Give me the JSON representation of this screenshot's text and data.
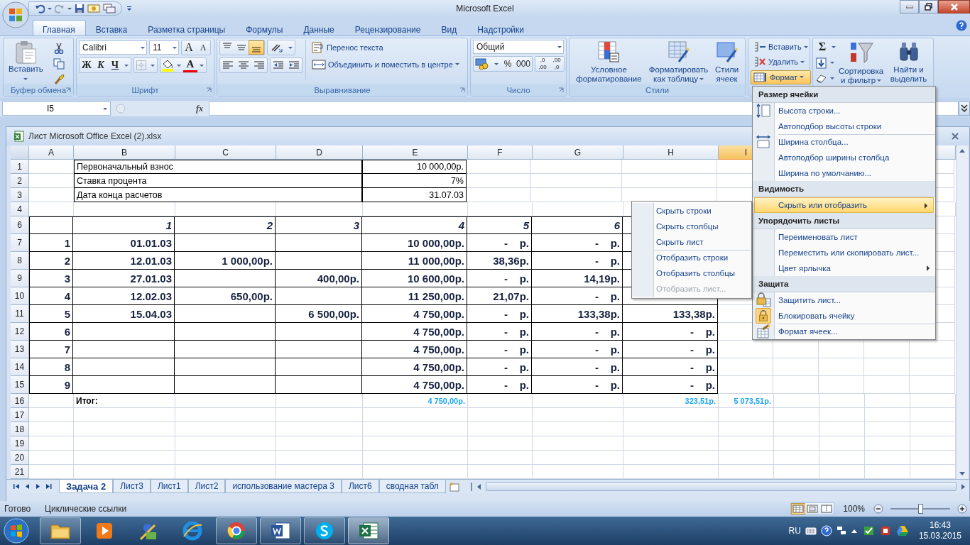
{
  "window": {
    "title": "Microsoft Excel"
  },
  "ribbon_tabs": [
    {
      "label": "Главная",
      "selected": true
    },
    {
      "label": "Вставка",
      "selected": false
    },
    {
      "label": "Разметка страницы",
      "selected": false
    },
    {
      "label": "Формулы",
      "selected": false
    },
    {
      "label": "Данные",
      "selected": false
    },
    {
      "label": "Рецензирование",
      "selected": false
    },
    {
      "label": "Вид",
      "selected": false
    },
    {
      "label": "Надстройки",
      "selected": false
    }
  ],
  "clipboard": {
    "title": "Буфер обмена",
    "paste": "Вставить"
  },
  "font": {
    "title": "Шрифт",
    "font_name": "Calibri",
    "font_size": "11",
    "grow": "A",
    "shrink": "A",
    "bold": "Ж",
    "italic": "К",
    "underline": "Ч",
    "font_color": "A"
  },
  "alignment": {
    "title": "Выравнивание",
    "vertical": [
      {
        "kind": "top",
        "selected": false
      },
      {
        "kind": "middle",
        "selected": false
      },
      {
        "kind": "bottom",
        "selected": true
      }
    ],
    "wrap_text": "Перенос текста",
    "merge": "Объединить и поместить в центре"
  },
  "number": {
    "title": "Число",
    "format": "Общий",
    "percent": "%",
    "thousands": "000",
    "increase_decimal": [
      ",0",
      ",00"
    ],
    "decrease_decimal": [
      ",00",
      ",0"
    ]
  },
  "styles": {
    "title": "Стили",
    "buttons": [
      {
        "label": "Условное\nформатирование",
        "kind": "conditional"
      },
      {
        "label": "Форматировать\nкак таблицу",
        "kind": "table"
      },
      {
        "label": "Стили\nячеек",
        "kind": "cell"
      }
    ]
  },
  "cells": {
    "buttons": [
      {
        "label": "Вставить",
        "kind": "insert",
        "selected": false
      },
      {
        "label": "Удалить",
        "kind": "delete",
        "selected": false
      },
      {
        "label": "Формат",
        "kind": "format",
        "selected": true
      }
    ]
  },
  "editing": {
    "sigma": "Σ",
    "buttons": [
      {
        "label": "Сортировка\nи фильтр",
        "kind": "sort"
      },
      {
        "label": "Найти и\nвыделить",
        "kind": "find"
      }
    ]
  },
  "formula_bar": {
    "name_box": "I5",
    "fx": "fx"
  },
  "workbook": {
    "title": "Лист Microsoft Office Excel (2).xlsx"
  },
  "sheet": {
    "columns": [
      {
        "label": "A",
        "selected": false
      },
      {
        "label": "B",
        "selected": false
      },
      {
        "label": "C",
        "selected": false
      },
      {
        "label": "D",
        "selected": false
      },
      {
        "label": "E",
        "selected": false
      },
      {
        "label": "F",
        "selected": false
      },
      {
        "label": "G",
        "selected": false
      },
      {
        "label": "H",
        "selected": false
      },
      {
        "label": "I",
        "selected": true
      }
    ],
    "rows": [
      {
        "number": "1",
        "kind": "info",
        "cells": {
          "B": "Первоначальный взнос",
          "E": "10 000,00р."
        }
      },
      {
        "number": "2",
        "kind": "info",
        "cells": {
          "B": "Ставка процента",
          "E": "7%"
        }
      },
      {
        "number": "3",
        "kind": "info",
        "cells": {
          "B": "Дата конца расчетов",
          "E": "31.07.03"
        }
      },
      {
        "number": "4",
        "kind": "blank",
        "cells": {}
      },
      {
        "number": "6",
        "kind": "table-head",
        "cells": {
          "B": "1",
          "C": "2",
          "D": "3",
          "E": "4",
          "F": "5",
          "G": "6"
        }
      },
      {
        "number": "7",
        "kind": "table",
        "cells": {
          "A": "1",
          "B": "01.01.03",
          "E": "10 000,00р.",
          "F": "-    р.",
          "G": "-    р."
        }
      },
      {
        "number": "8",
        "kind": "table",
        "cells": {
          "A": "2",
          "B": "12.01.03",
          "C": "1 000,00р.",
          "E": "11 000,00р.",
          "F": "38,36р.",
          "G": "-    р."
        }
      },
      {
        "number": "9",
        "kind": "table",
        "cells": {
          "A": "3",
          "B": "27.01.03",
          "D": "400,00р.",
          "E": "10 600,00р.",
          "F": "-    р.",
          "G": "14,19р."
        }
      },
      {
        "number": "10",
        "kind": "table",
        "cells": {
          "A": "4",
          "B": "12.02.03",
          "C": "650,00р.",
          "E": "11 250,00р.",
          "F": "21,07р.",
          "G": "-    р."
        }
      },
      {
        "number": "11",
        "kind": "table",
        "cells": {
          "A": "5",
          "B": "15.04.03",
          "D": "6 500,00р.",
          "E": "4 750,00р.",
          "F": "-    р.",
          "G": "133,38р.",
          "H": "133,38р."
        }
      },
      {
        "number": "12",
        "kind": "table",
        "cells": {
          "A": "6",
          "E": "4 750,00р.",
          "F": "-    р.",
          "G": "-    р.",
          "H": "-    р."
        }
      },
      {
        "number": "13",
        "kind": "table",
        "cells": {
          "A": "7",
          "E": "4 750,00р.",
          "F": "-    р.",
          "G": "-    р.",
          "H": "-    р."
        }
      },
      {
        "number": "14",
        "kind": "table",
        "cells": {
          "A": "8",
          "E": "4 750,00р.",
          "F": "-    р.",
          "G": "-    р.",
          "H": "-    р."
        }
      },
      {
        "number": "15",
        "kind": "table",
        "cells": {
          "A": "9",
          "E": "4 750,00р.",
          "F": "-    р.",
          "G": "-    р.",
          "H": "-    р."
        }
      },
      {
        "number": "16",
        "kind": "total",
        "cells": {
          "B": "Итог:",
          "E": "4 750,00р.",
          "H": "323,51р.",
          "I": "5 073,51р."
        }
      },
      {
        "number": "17",
        "kind": "blank",
        "cells": {}
      },
      {
        "number": "18",
        "kind": "blank",
        "cells": {}
      },
      {
        "number": "19",
        "kind": "blank",
        "cells": {}
      },
      {
        "number": "20",
        "kind": "blank",
        "cells": {}
      },
      {
        "number": "21",
        "kind": "blank",
        "cells": {}
      }
    ]
  },
  "sheet_tabs": [
    {
      "label": "Задача 2",
      "selected": true
    },
    {
      "label": "Лист3",
      "selected": false
    },
    {
      "label": "Лист1",
      "selected": false
    },
    {
      "label": "Лист2",
      "selected": false
    },
    {
      "label": "использование мастера 3",
      "selected": false
    },
    {
      "label": "Лист6",
      "selected": false
    },
    {
      "label": "сводная табл",
      "selected": false
    }
  ],
  "format_menu": {
    "sections": [
      {
        "title": "Размер ячейки",
        "items": [
          {
            "label": "Высота строки...",
            "kind": "row-height",
            "separator_above": false,
            "highlighted": false,
            "submenu": false,
            "checked": false
          },
          {
            "label": "Автоподбор высоты строки",
            "kind": "plain",
            "separator_above": false,
            "highlighted": false,
            "submenu": false,
            "checked": false
          },
          {
            "label": "Ширина столбца...",
            "kind": "column-width",
            "separator_above": true,
            "highlighted": false,
            "submenu": false,
            "checked": false
          },
          {
            "label": "Автоподбор ширины столбца",
            "kind": "plain",
            "separator_above": false,
            "highlighted": false,
            "submenu": false,
            "checked": false
          },
          {
            "label": "Ширина по умолчанию...",
            "kind": "plain",
            "separator_above": false,
            "highlighted": false,
            "submenu": false,
            "checked": false
          }
        ]
      },
      {
        "title": "Видимость",
        "items": [
          {
            "label": "Скрыть или отобразить",
            "kind": "plain",
            "separator_above": false,
            "highlighted": true,
            "submenu": true,
            "checked": false
          }
        ]
      },
      {
        "title": "Упорядочить листы",
        "items": [
          {
            "label": "Переименовать лист",
            "kind": "plain",
            "separator_above": false,
            "highlighted": false,
            "submenu": false,
            "checked": false
          },
          {
            "label": "Переместить или скопировать лист...",
            "kind": "plain",
            "separator_above": false,
            "highlighted": false,
            "submenu": false,
            "checked": false
          },
          {
            "label": "Цвет ярлычка",
            "kind": "plain",
            "separator_above": false,
            "highlighted": false,
            "submenu": true,
            "checked": false
          }
        ]
      },
      {
        "title": "Защита",
        "items": [
          {
            "label": "Защитить лист...",
            "kind": "lock-sheet",
            "separator_above": false,
            "highlighted": false,
            "submenu": false,
            "checked": false
          },
          {
            "label": "Блокировать ячейку",
            "kind": "lock",
            "separator_above": false,
            "highlighted": false,
            "submenu": false,
            "checked": true
          },
          {
            "label": "Формат ячеек...",
            "kind": "format-cells",
            "separator_above": true,
            "highlighted": false,
            "submenu": false,
            "checked": false
          }
        ]
      }
    ]
  },
  "hide_submenu": {
    "items": [
      {
        "label": "Скрыть строки",
        "separator_above": false,
        "disabled": false
      },
      {
        "label": "Скрыть столбцы",
        "separator_above": false,
        "disabled": false
      },
      {
        "label": "Скрыть лист",
        "separator_above": false,
        "disabled": false
      },
      {
        "label": "Отобразить строки",
        "separator_above": true,
        "disabled": false
      },
      {
        "label": "Отобразить столбцы",
        "separator_above": false,
        "disabled": false
      },
      {
        "label": "Отобразить лист...",
        "separator_above": false,
        "disabled": true
      }
    ]
  },
  "status_bar": {
    "items": [
      "Готово",
      "Циклические ссылки"
    ],
    "views": [
      {
        "kind": "normal",
        "selected": true
      },
      {
        "kind": "layout",
        "selected": false
      },
      {
        "kind": "page-break",
        "selected": false
      }
    ],
    "zoom": {
      "label": "100%",
      "level": 0.5
    }
  },
  "taskbar": {
    "apps": [
      {
        "kind": "folder",
        "running": true,
        "selected": false
      },
      {
        "kind": "media",
        "running": false,
        "selected": false
      },
      {
        "kind": "wizard",
        "running": false,
        "selected": false
      },
      {
        "kind": "browser-e",
        "running": false,
        "selected": false
      },
      {
        "kind": "browser-circle",
        "running": true,
        "selected": false
      },
      {
        "kind": "word",
        "running": true,
        "selected": false
      },
      {
        "kind": "skype",
        "running": true,
        "selected": false
      },
      {
        "kind": "excel",
        "running": true,
        "selected": true
      }
    ],
    "language": "RU",
    "time": "16:43",
    "date": "15.03.2015"
  }
}
